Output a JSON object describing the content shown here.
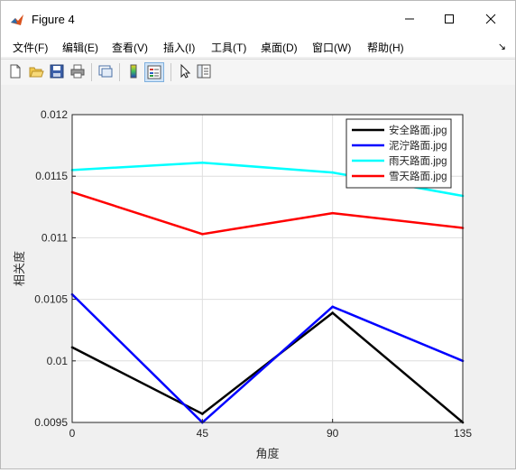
{
  "window": {
    "title": "Figure 4"
  },
  "menu": [
    "文件(F)",
    "编辑(E)",
    "查看(V)",
    "插入(I)",
    "工具(T)",
    "桌面(D)",
    "窗口(W)",
    "帮助(H)"
  ],
  "toolbar": {
    "icons": [
      "new-figure-icon",
      "open-file-icon",
      "save-icon",
      "print-icon",
      "link-plot-icon",
      "colorbar-icon",
      "legend-icon",
      "pointer-icon",
      "property-inspector-icon"
    ]
  },
  "chart_data": {
    "type": "line",
    "x": [
      0,
      45,
      90,
      135
    ],
    "xlabel": "角度",
    "ylabel": "相关度",
    "xlim": [
      0,
      135
    ],
    "ylim": [
      0.0095,
      0.012
    ],
    "xticks": [
      "0",
      "45",
      "90",
      "135"
    ],
    "yticks": [
      "0.0095",
      "0.01",
      "0.0105",
      "0.011",
      "0.0115",
      "0.012"
    ],
    "grid": true,
    "legend_position": "top-right",
    "series": [
      {
        "name": "安全路面.jpg",
        "color": "#000000",
        "values": [
          0.01011,
          0.00957,
          0.01039,
          0.0095
        ]
      },
      {
        "name": "泥泞路面.jpg",
        "color": "#0000ff",
        "values": [
          0.01054,
          0.0095,
          0.01044,
          0.01
        ]
      },
      {
        "name": "雨天路面.jpg",
        "color": "#00ffff",
        "values": [
          0.01155,
          0.01161,
          0.01153,
          0.01134
        ]
      },
      {
        "name": "雪天路面.jpg",
        "color": "#ff0000",
        "values": [
          0.01137,
          0.01103,
          0.0112,
          0.01108
        ]
      }
    ]
  }
}
